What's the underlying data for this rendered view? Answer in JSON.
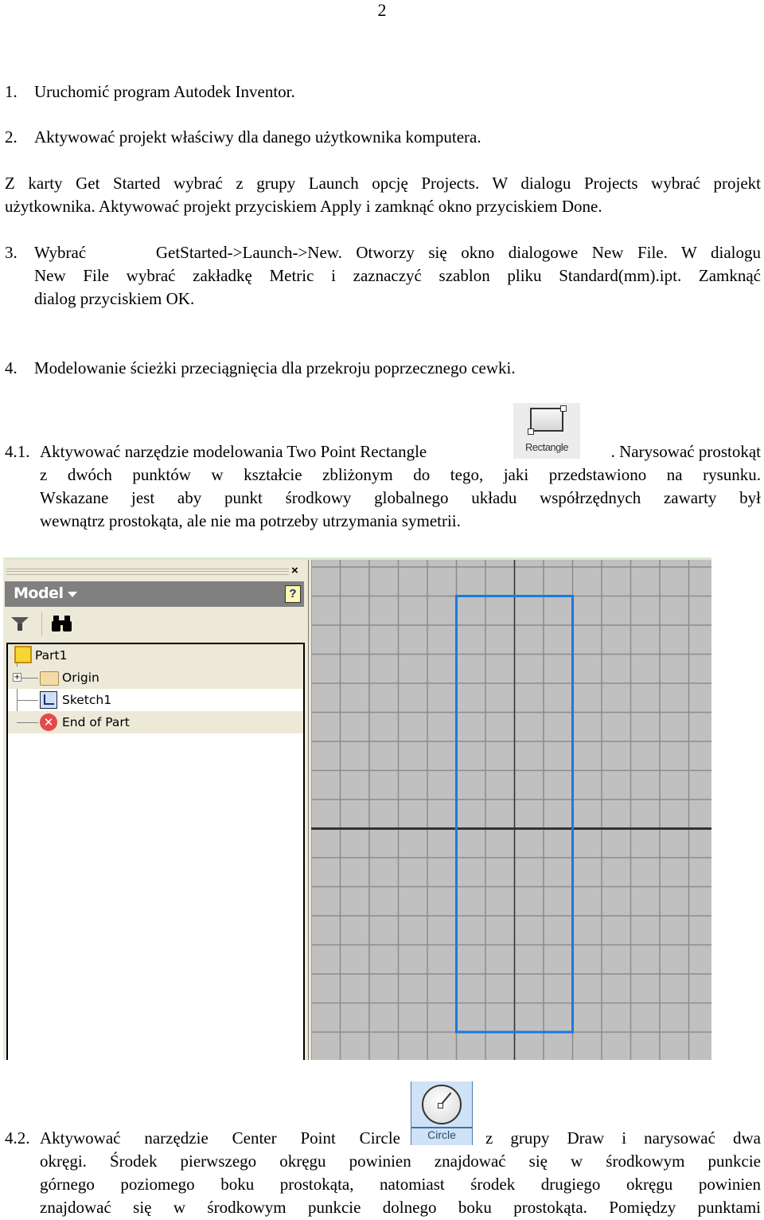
{
  "page_number": "2",
  "steps": {
    "s1": {
      "num": "1.",
      "text": "Uruchomić program Autodek Inventor."
    },
    "s2": {
      "num": "2.",
      "text": "Aktywować projekt właściwy dla danego użytkownika komputera."
    },
    "s2_note": {
      "line1": "Z karty Get Started wybrać z grupy Launch opcję Projects. W dialogu Projects wybrać projekt",
      "line2": "użytkownika. Aktywować projekt przyciskiem Apply i zamknąć okno przyciskiem Done."
    },
    "s3": {
      "num": "3.",
      "line1": "Wybrać     GetStarted->Launch->New. Otworzy się okno dialogowe New File. W dialogu",
      "line2": "New File wybrać zakładkę Metric i zaznaczyć szablon pliku Standard(mm).ipt. Zamknąć",
      "line3": "dialog przyciskiem OK."
    },
    "s4": {
      "num": "4.",
      "text": "Modelowanie ścieżki przeciągnięcia dla przekroju poprzecznego cewki."
    },
    "s4_1": {
      "num": "4.1.",
      "line1_before": "Aktywować narzędzie modelowania Two Point Rectangle",
      "line1_after": ". Narysować prostokąt",
      "line2": "z dwóch punktów w kształcie zbliżonym do tego, jaki przedstawiono na rysunku.",
      "line3": "Wskazane jest aby punkt środkowy globalnego układu współrzędnych zawarty był",
      "line4": "wewnątrz prostokąta, ale nie ma potrzeby utrzymania symetrii."
    },
    "s4_2": {
      "num": "4.2.",
      "line1_before": "Aktywować narzędzie Center Point Circle",
      "line1_after": "z grupy Draw i narysować dwa",
      "line2": "okręgi. Środek pierwszego okręgu powinien znajdować się w środkowym punkcie",
      "line3": "górnego poziomego boku prostokąta, natomiast środek drugiego okręgu powinien",
      "line4": "znajdować się w środkowym punkcie dolnego boku prostokąta. Pomiędzy punktami"
    }
  },
  "tools": {
    "rectangle": {
      "label": "Rectangle",
      "icon": "rectangle-tool-icon"
    },
    "circle": {
      "label": "Circle",
      "icon": "circle-tool-icon"
    }
  },
  "inventor": {
    "browser": {
      "close_glyph": "×",
      "title": "Model",
      "help_glyph": "?",
      "binoculars_glyph": "👓",
      "tree": [
        {
          "label": "Part1",
          "icon": "part-icon"
        },
        {
          "label": "Origin",
          "icon": "folder-icon",
          "expander": "+"
        },
        {
          "label": "Sketch1",
          "icon": "sketch-icon"
        },
        {
          "label": "End of Part",
          "icon": "end-of-part-icon",
          "glyph": "✕"
        }
      ]
    },
    "sketch": {
      "grid_color": "#8c8c8c",
      "background_color": "#c0c0c0",
      "axis_color": "#333333",
      "rectangle_color": "#1a7ae0",
      "grid_columns": 14,
      "grid_rows": 17,
      "rectangle_cells": {
        "from_col": 5,
        "to_col": 9,
        "from_row": 1,
        "to_row": 16
      },
      "axis_cells": {
        "vertical_col": 7,
        "horizontal_row": 9
      }
    }
  }
}
